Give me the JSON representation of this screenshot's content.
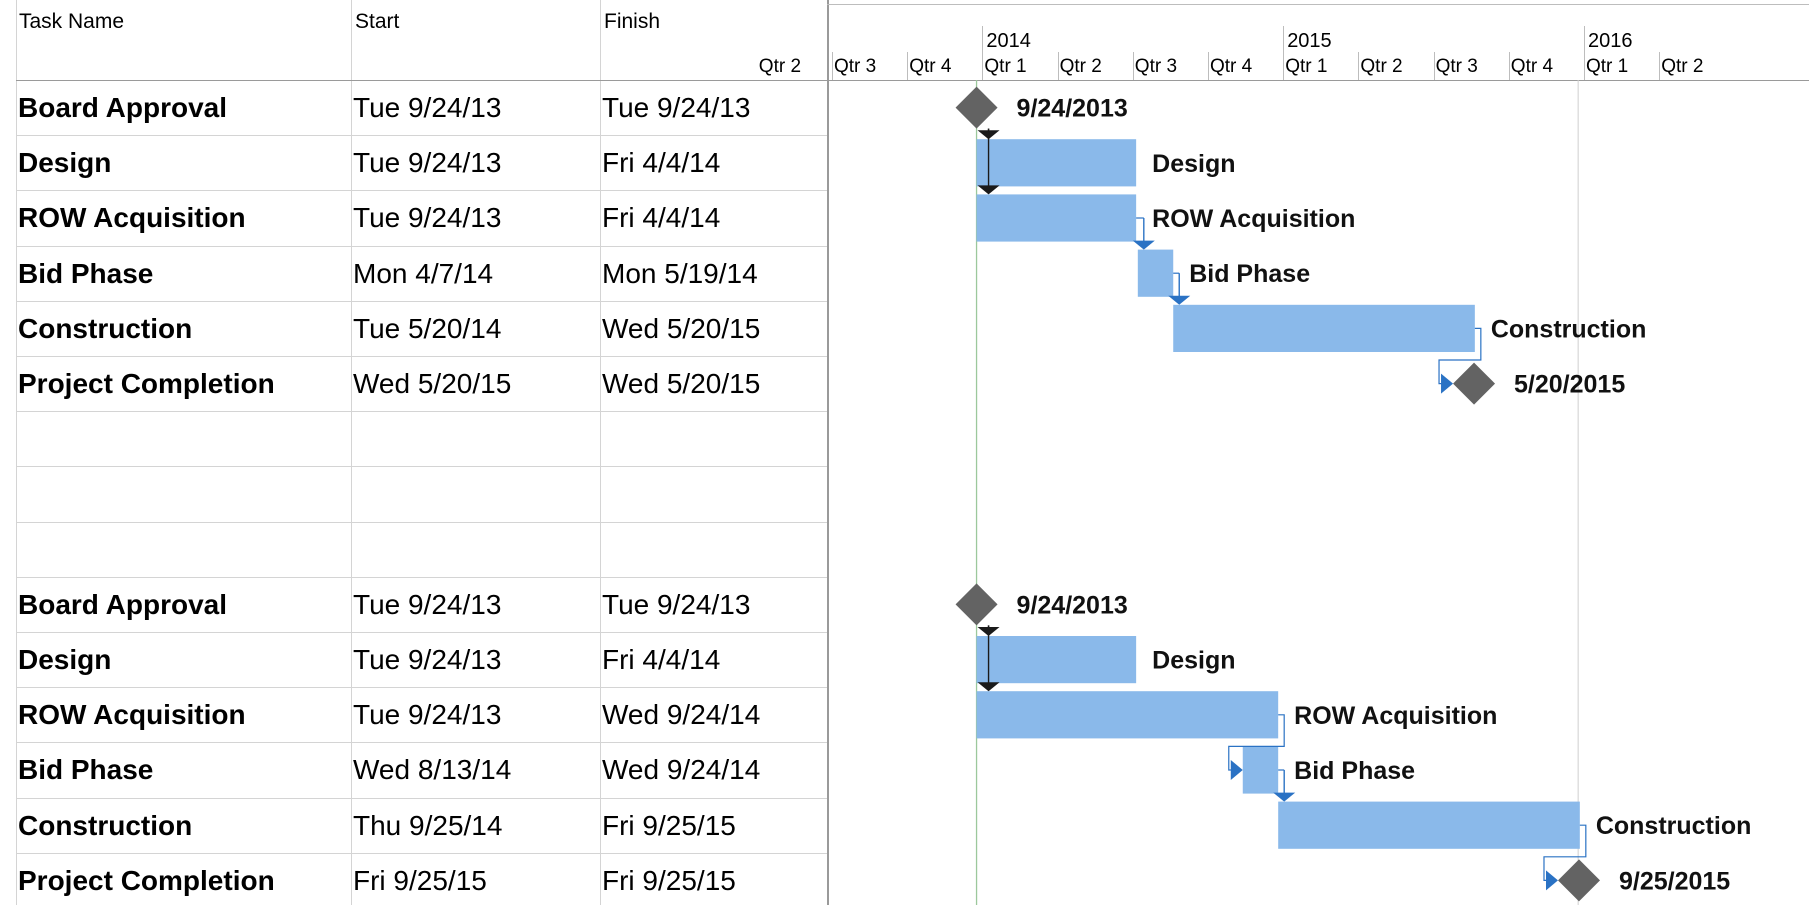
{
  "columns": {
    "task_name": "Task Name",
    "start": "Start",
    "finish": "Finish"
  },
  "timescale": {
    "years": [
      {
        "label": "2014",
        "quarter_index": 3
      },
      {
        "label": "2015",
        "quarter_index": 7
      },
      {
        "label": "2016",
        "quarter_index": 11
      }
    ],
    "quarters": [
      "Qtr 2",
      "Qtr 3",
      "Qtr 4",
      "Qtr 1",
      "Qtr 2",
      "Qtr 3",
      "Qtr 4",
      "Qtr 1",
      "Qtr 2",
      "Qtr 3",
      "Qtr 4",
      "Qtr 1",
      "Qtr 2"
    ],
    "first_quarter_start": "2013-04-01",
    "today_line": "2013-09-24",
    "deadline_line": "2015-09-24"
  },
  "colors": {
    "bar": "#8ab9ea",
    "milestone": "#636363",
    "link": "#2a72c4",
    "link_dark": "#1a1a1a",
    "grid": "#d4d4d4",
    "today": "#9cc89c"
  },
  "tasks": [
    {
      "row": 0,
      "name": "Board Approval",
      "start_text": "Tue 9/24/13",
      "finish_text": "Tue 9/24/13",
      "start": "2013-09-24",
      "finish": "2013-09-24",
      "milestone": true,
      "bar_label": "9/24/2013"
    },
    {
      "row": 1,
      "name": "Design",
      "start_text": "Tue 9/24/13",
      "finish_text": "Fri 4/4/14",
      "start": "2013-09-24",
      "finish": "2014-04-05",
      "milestone": false,
      "bar_label": "Design"
    },
    {
      "row": 2,
      "name": "ROW Acquisition",
      "start_text": "Tue 9/24/13",
      "finish_text": "Fri 4/4/14",
      "start": "2013-09-24",
      "finish": "2014-04-05",
      "milestone": false,
      "bar_label": "ROW Acquisition"
    },
    {
      "row": 3,
      "name": "Bid Phase",
      "start_text": "Mon 4/7/14",
      "finish_text": "Mon 5/19/14",
      "start": "2014-04-07",
      "finish": "2014-05-20",
      "milestone": false,
      "bar_label": "Bid Phase"
    },
    {
      "row": 4,
      "name": "Construction",
      "start_text": "Tue 5/20/14",
      "finish_text": "Wed 5/20/15",
      "start": "2014-05-20",
      "finish": "2015-05-21",
      "milestone": false,
      "bar_label": "Construction"
    },
    {
      "row": 5,
      "name": "Project Completion",
      "start_text": "Wed 5/20/15",
      "finish_text": "Wed 5/20/15",
      "start": "2015-05-20",
      "finish": "2015-05-20",
      "milestone": true,
      "bar_label": "5/20/2015"
    },
    {
      "row": 9,
      "name": "Board Approval",
      "start_text": "Tue 9/24/13",
      "finish_text": "Tue 9/24/13",
      "start": "2013-09-24",
      "finish": "2013-09-24",
      "milestone": true,
      "bar_label": "9/24/2013"
    },
    {
      "row": 10,
      "name": "Design",
      "start_text": "Tue 9/24/13",
      "finish_text": "Fri 4/4/14",
      "start": "2013-09-24",
      "finish": "2014-04-05",
      "milestone": false,
      "bar_label": "Design"
    },
    {
      "row": 11,
      "name": "ROW Acquisition",
      "start_text": "Tue 9/24/13",
      "finish_text": "Wed 9/24/14",
      "start": "2013-09-24",
      "finish": "2014-09-25",
      "milestone": false,
      "bar_label": "ROW Acquisition"
    },
    {
      "row": 12,
      "name": "Bid Phase",
      "start_text": "Wed 8/13/14",
      "finish_text": "Wed 9/24/14",
      "start": "2014-08-13",
      "finish": "2014-09-25",
      "milestone": false,
      "bar_label": "Bid Phase"
    },
    {
      "row": 13,
      "name": "Construction",
      "start_text": "Thu 9/25/14",
      "finish_text": "Fri 9/25/15",
      "start": "2014-09-25",
      "finish": "2015-09-26",
      "milestone": false,
      "bar_label": "Construction"
    },
    {
      "row": 14,
      "name": "Project Completion",
      "start_text": "Fri 9/25/15",
      "finish_text": "Fri 9/25/15",
      "start": "2015-09-25",
      "finish": "2015-09-25",
      "milestone": true,
      "bar_label": "9/25/2015"
    }
  ],
  "links": [
    {
      "from": 0,
      "to": 1,
      "dark": true
    },
    {
      "from": 0,
      "to": 2,
      "dark": true
    },
    {
      "from": 2,
      "to": 3,
      "dark": false
    },
    {
      "from": 3,
      "to": 4,
      "dark": false
    },
    {
      "from": 4,
      "to": 5,
      "dark": false
    },
    {
      "from": 9,
      "to": 10,
      "dark": true
    },
    {
      "from": 9,
      "to": 11,
      "dark": true
    },
    {
      "from": 11,
      "to": 12,
      "dark": false
    },
    {
      "from": 12,
      "to": 13,
      "dark": false
    },
    {
      "from": 13,
      "to": 14,
      "dark": false
    }
  ]
}
